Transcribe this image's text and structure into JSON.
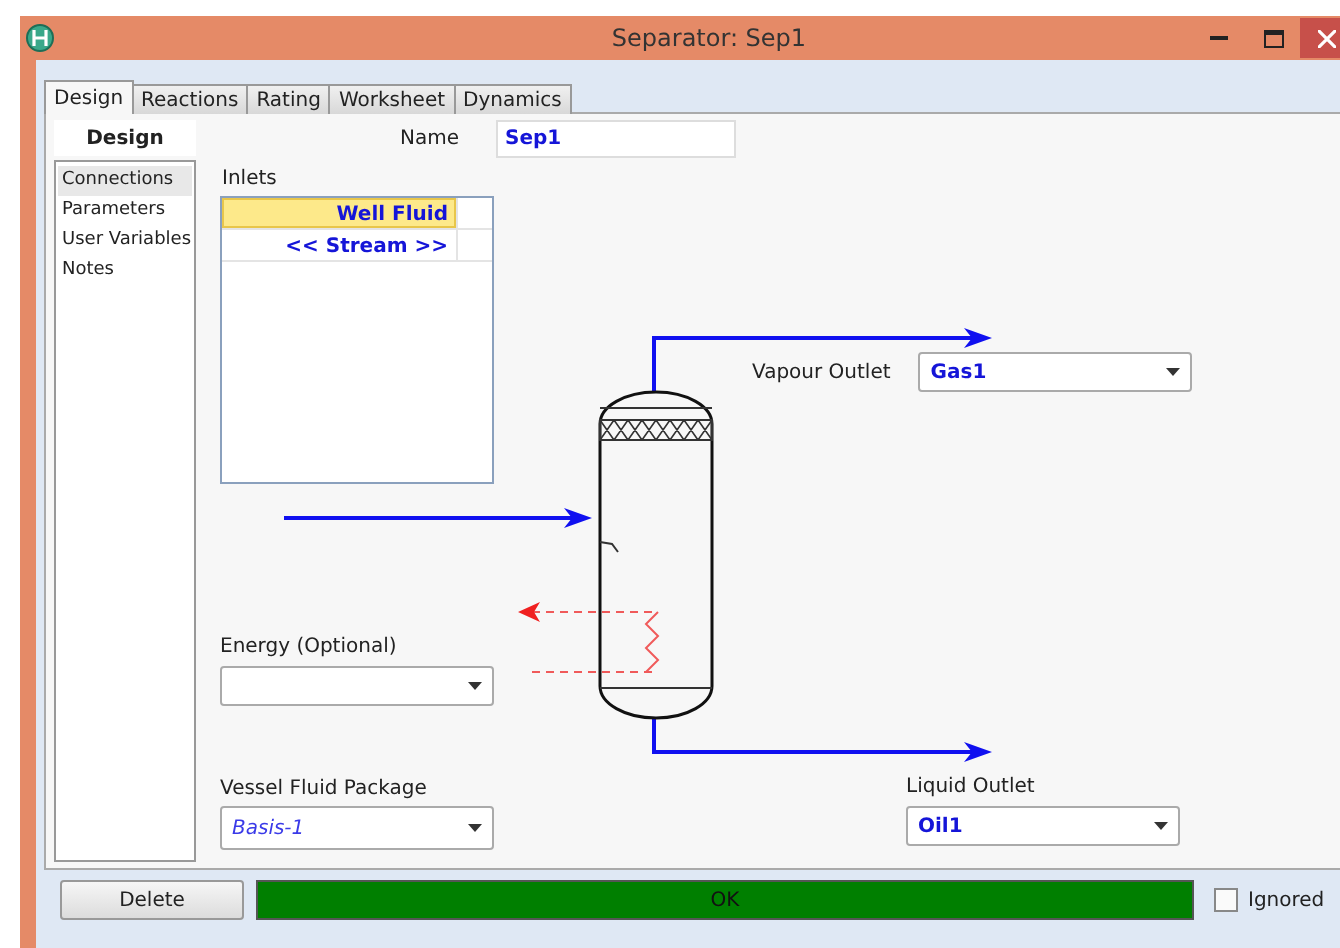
{
  "window": {
    "title": "Separator: Sep1"
  },
  "tabs": [
    {
      "label": "Design",
      "selected": true
    },
    {
      "label": "Reactions",
      "selected": false
    },
    {
      "label": "Rating",
      "selected": false
    },
    {
      "label": "Worksheet",
      "selected": false
    },
    {
      "label": "Dynamics",
      "selected": false
    }
  ],
  "sidebar": {
    "title": "Design",
    "items": [
      {
        "label": "Connections",
        "selected": true
      },
      {
        "label": "Parameters",
        "selected": false
      },
      {
        "label": "User Variables",
        "selected": false
      },
      {
        "label": "Notes",
        "selected": false
      }
    ]
  },
  "name": {
    "label": "Name",
    "value": "Sep1"
  },
  "inlets": {
    "label": "Inlets",
    "rows": [
      {
        "text": "Well Fluid",
        "selected": true
      },
      {
        "text": "<< Stream >>",
        "selected": false
      }
    ]
  },
  "energy": {
    "label": "Energy (Optional)"
  },
  "vessel_fluid_package": {
    "label": "Vessel Fluid Package",
    "value": "Basis-1"
  },
  "vapour_outlet": {
    "label": "Vapour Outlet",
    "value": "Gas1"
  },
  "liquid_outlet": {
    "label": "Liquid Outlet",
    "value": "Oil1"
  },
  "footer": {
    "delete_button": "Delete",
    "status": "OK",
    "ignored": {
      "label": "Ignored",
      "checked": false
    }
  }
}
